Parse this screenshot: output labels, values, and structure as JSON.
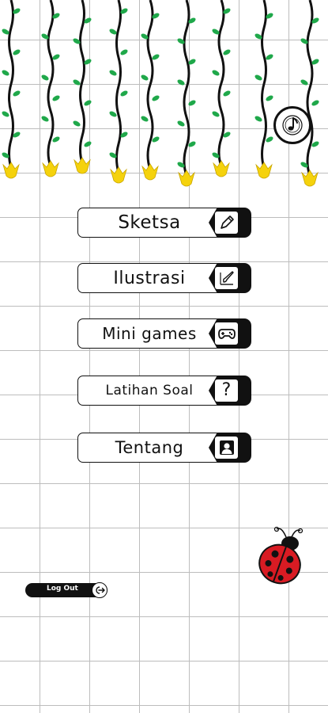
{
  "menu": [
    {
      "label": "Sketsa",
      "icon": "pencil-icon"
    },
    {
      "label": "Ilustrasi",
      "icon": "brush-icon"
    },
    {
      "label": "Mini games",
      "icon": "gamepad-icon"
    },
    {
      "label": "Latihan Soal",
      "icon": "question-icon"
    },
    {
      "label": "Tentang",
      "icon": "person-icon"
    }
  ],
  "logout": {
    "label": "Log Out",
    "icon": "logout-icon"
  },
  "music_button": {
    "icon": "music-note-icon"
  },
  "colors": {
    "leaf": "#1fa84a",
    "flower": "#f5d20c",
    "ladybug": "#d81b23",
    "ink": "#111111"
  }
}
